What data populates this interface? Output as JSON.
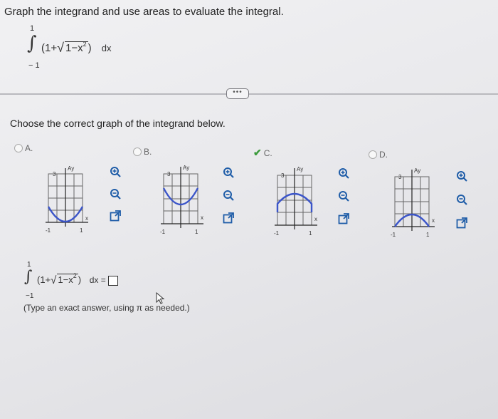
{
  "header": {
    "title": "Graph the integrand and use areas to evaluate the integral."
  },
  "integral": {
    "upper": "1",
    "lower": "− 1",
    "one_plus": "(1+",
    "radicand": "1−x",
    "power": "2",
    "close": ")",
    "dx": "dx"
  },
  "more_button": {
    "label": "•••"
  },
  "question": {
    "text": "Choose the correct graph of the integrand below."
  },
  "options": [
    {
      "letter": "A.",
      "selected": false
    },
    {
      "letter": "B.",
      "selected": false
    },
    {
      "letter": "C.",
      "selected": true
    },
    {
      "letter": "D.",
      "selected": false
    }
  ],
  "graph_labels": {
    "y_tick": "3",
    "x_neg": "-1",
    "x_pos": "1",
    "x_axis": "x",
    "y_axis": "Ay"
  },
  "answer": {
    "upper": "1",
    "lower": "−1",
    "dx_equals": "dx =",
    "hint": "(Type an exact answer, using π as needed.)"
  },
  "colors": {
    "curve": "#3b55c9",
    "check": "#3a9a3a",
    "icon": "#1f5da8"
  }
}
